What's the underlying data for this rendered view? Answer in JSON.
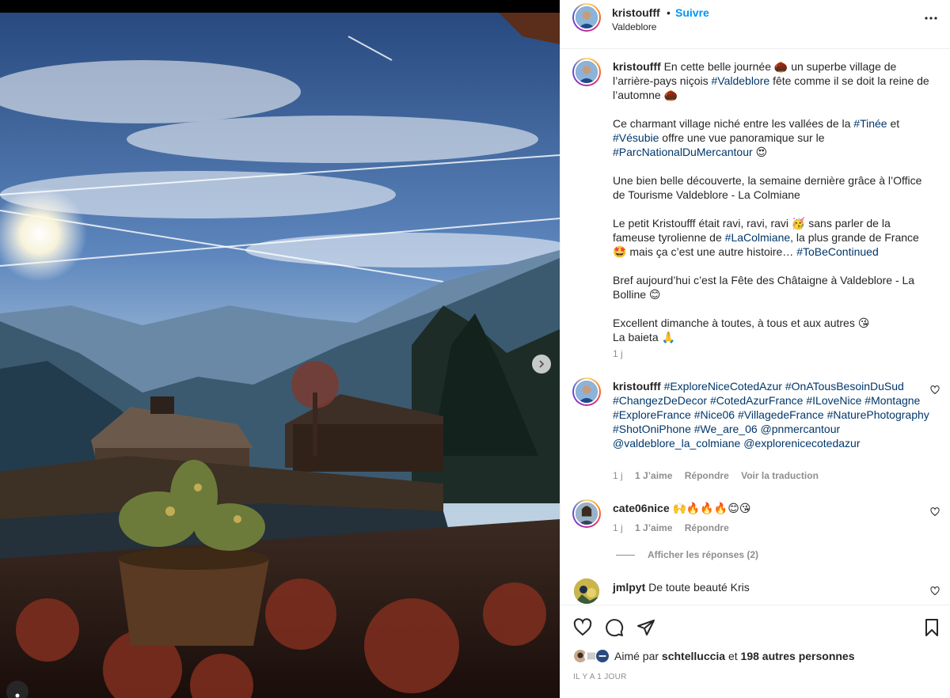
{
  "post": {
    "username": "kristoufff",
    "separator": "•",
    "follow_label": "Suivre",
    "location": "Valdeblore"
  },
  "caption": {
    "username": "kristoufff",
    "p1a": "En cette belle journée",
    "p1b": "un superbe village de l’arrière-pays niçois",
    "p1c": "#Valdeblore",
    "p1d": "fête comme il se doit la reine de l’automne",
    "p2a": "Ce charmant village niché entre les vallées de la",
    "p2b": "#Tinée",
    "p2c": "et",
    "p2d": "#Vésubie",
    "p2e": "offre une vue panoramique sur le",
    "p2f": "#ParcNationalDuMercantour",
    "p3": "Une bien belle découverte, la semaine dernière grâce à l’Office de Tourisme Valdeblore - La Colmiane",
    "p4a": "Le petit Kristoufff était ravi, ravi, ravi",
    "p4b": "sans parler de la fameuse tyrolienne de",
    "p4c": "#LaColmiane",
    "p4d": ", la plus grande de France",
    "p4e": "mais ça c’est une autre histoire…",
    "p4f": "#ToBeContinued",
    "p5": "Bref aujourd’hui c’est la Fête des Châtaigne à Valdeblore - La Bolline",
    "p6a": "Excellent dimanche à toutes, à tous et aux autres",
    "p6b": "La baieta",
    "time": "1 j"
  },
  "comments": [
    {
      "username": "kristoufff",
      "tags": "#ExploreNiceCotedAzur #OnATousBesoinDuSud #ChangezDeDecor #CotedAzurFrance #ILoveNice #Montagne #ExploreFrance #Nice06 #VillagedeFrance #NaturePhotography #ShotOniPhone #We_are_06 @pnmercantour @valdeblore_la_colmiane @explorenicecotedazur",
      "time": "1 j",
      "likes": "1 J’aime",
      "reply": "Répondre",
      "translate": "Voir la traduction"
    },
    {
      "username": "cate06nice",
      "text": "🙌🔥🔥🔥😊😘",
      "time": "1 j",
      "likes": "1 J’aime",
      "reply": "Répondre",
      "show_replies": "Afficher les réponses (2)"
    },
    {
      "username": "jmlpyt",
      "text": "De toute beauté Kris"
    }
  ],
  "likes": {
    "prefix": "Aimé par",
    "user": "schtelluccia",
    "middle": "et",
    "others": "198 autres personnes"
  },
  "timeago": "IL Y A 1 JOUR",
  "colors": {
    "link": "#00376b",
    "follow": "#0095f6",
    "muted": "#8e8e8e"
  }
}
